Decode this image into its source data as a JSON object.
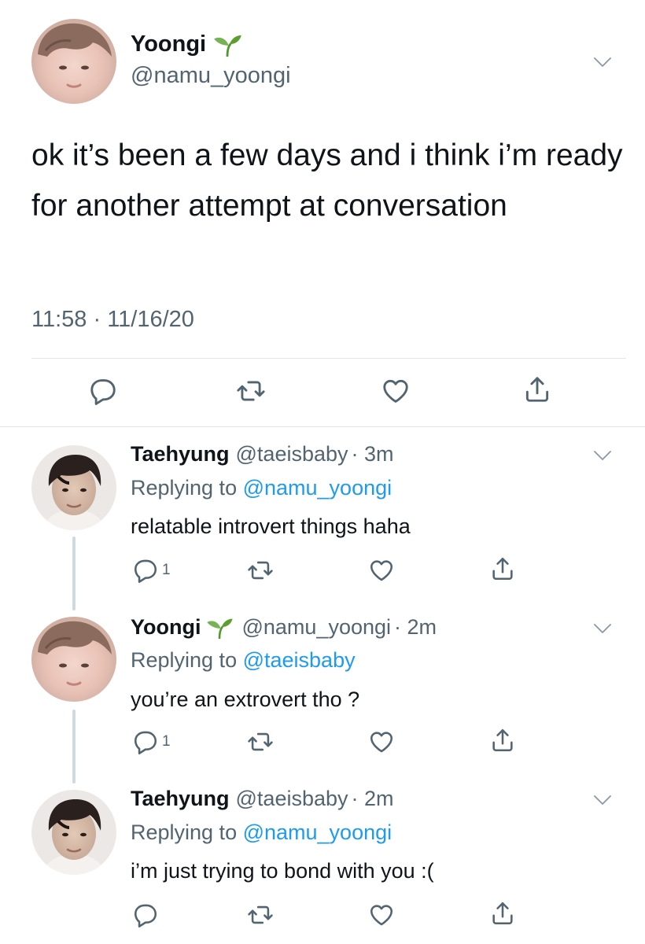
{
  "colors": {
    "link": "#1d9bf0",
    "secondary_text": "#536471",
    "divider": "#e1e5e8"
  },
  "main_tweet": {
    "name": "Yoongi",
    "name_emoji": "seedling-icon",
    "handle": "@namu_yoongi",
    "text": "ok it’s been a few days and i think i’m ready for another attempt at conversation",
    "timestamp": "11:58 · 11/16/20",
    "actions": [
      "reply-icon",
      "retweet-icon",
      "like-icon",
      "share-icon"
    ]
  },
  "replies": [
    {
      "name": "Taehyung",
      "handle": "@taeisbaby",
      "time": "· 3m",
      "replying_prefix": "Replying to ",
      "replying_to": "@namu_yoongi",
      "text": "relatable introvert things haha",
      "reply_count": "1"
    },
    {
      "name": "Yoongi",
      "name_emoji": "seedling-icon",
      "handle": "@namu_yoongi",
      "time": "· 2m",
      "replying_prefix": "Replying to ",
      "replying_to": "@taeisbaby",
      "text": "you’re an extrovert tho ?",
      "reply_count": "1"
    },
    {
      "name": "Taehyung",
      "handle": "@taeisbaby",
      "time": "· 2m",
      "replying_prefix": "Replying to ",
      "replying_to": "@namu_yoongi",
      "text": "i’m just trying to bond with you :(",
      "reply_count": ""
    }
  ]
}
